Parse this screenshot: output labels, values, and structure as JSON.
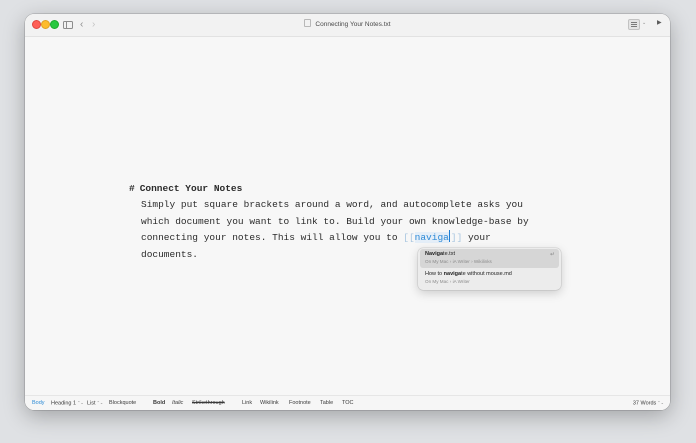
{
  "window": {
    "title": "Connecting Your Notes.txt"
  },
  "toolbar": {
    "back_icon": "‹",
    "forward_icon": "›",
    "chevron_icon": "⌄",
    "play_icon": "▶"
  },
  "editor": {
    "heading_marker": "#",
    "heading_text": "Connect Your Notes",
    "lines": [
      "Simply put square brackets around a word, and autocomplete asks you",
      "which document you want to link to. Build your own knowledge-base by",
      "connecting your notes. This will allow you to ",
      "documents."
    ],
    "wikilink_open": "[[",
    "wikilink_query": "naviga",
    "wikilink_close": "]]",
    "after_link": " your"
  },
  "autocomplete": {
    "items": [
      {
        "match": "Naviga",
        "rest": "te.txt",
        "subtitle": "On My Mac › iA Writer › Wikilinks",
        "selected": true
      },
      {
        "prefix": "How to ",
        "match": "naviga",
        "rest": "te without mouse.md",
        "subtitle": "On My Mac › iA Writer"
      }
    ],
    "return_icon": "↵"
  },
  "statusbar": {
    "body": "Body",
    "heading": "Heading 1",
    "list": "List",
    "blockquote": "Blockquote",
    "bold": "Bold",
    "italic": "Italic",
    "strikethrough": "Strikethrough",
    "link": "Link",
    "wikilink": "Wikilink",
    "footnote": "Footnote",
    "table": "Table",
    "toc": "TOC",
    "word_count": "37 Words",
    "chevron": "⌃⌄"
  },
  "colors": {
    "accent": "#2e8ad6",
    "close": "#fe5f57",
    "minimize": "#febc2e",
    "zoom": "#28c840"
  }
}
